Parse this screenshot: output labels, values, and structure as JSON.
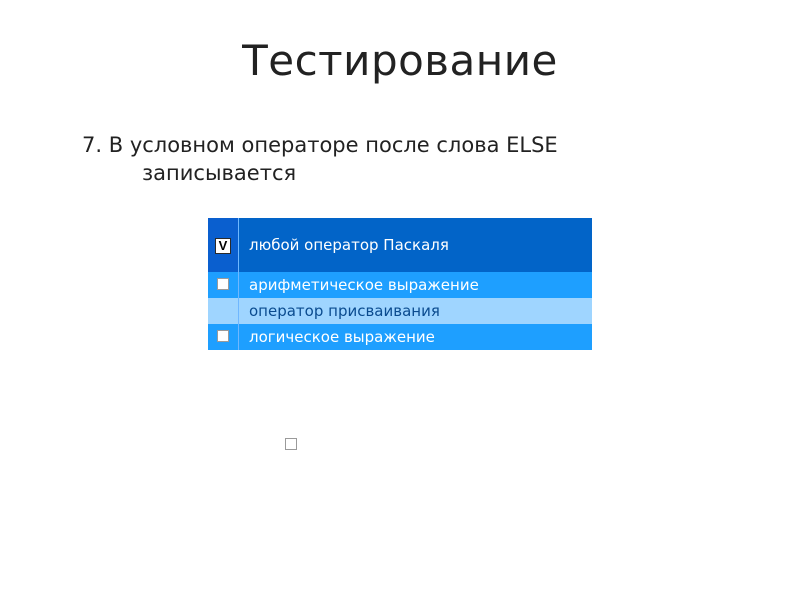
{
  "title": "Тестирование",
  "question": {
    "number": "7.",
    "line1": "В условном операторе после слова ELSE",
    "line2": "записывается"
  },
  "answers": [
    {
      "label": "любой оператор Паскаля",
      "checked": true,
      "mark": "V"
    },
    {
      "label": "арифметическое выражение",
      "checked": false,
      "mark": ""
    },
    {
      "label": "оператор присваивания",
      "checked": false,
      "mark": ""
    },
    {
      "label": "логическое выражение",
      "checked": false,
      "mark": ""
    }
  ]
}
